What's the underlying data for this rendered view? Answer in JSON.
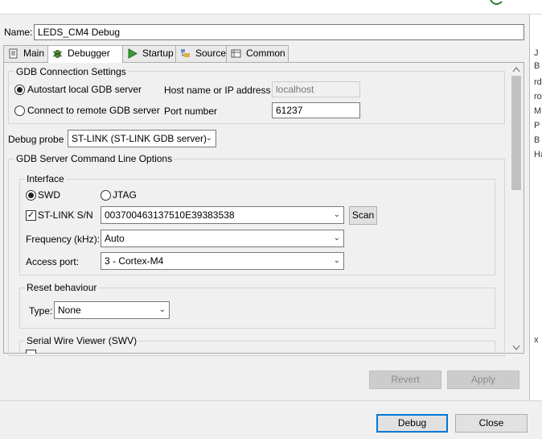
{
  "name": {
    "label": "Name:",
    "value": "LEDS_CM4 Debug"
  },
  "tabs": [
    {
      "label": "Main",
      "icon": "document-icon"
    },
    {
      "label": "Debugger",
      "icon": "bug-icon"
    },
    {
      "label": "Startup",
      "icon": "play-icon"
    },
    {
      "label": "Source",
      "icon": "source-icon"
    },
    {
      "label": "Common",
      "icon": "table-icon"
    }
  ],
  "gdb_connection": {
    "title": "GDB Connection Settings",
    "autostart_label": "Autostart local GDB server",
    "remote_label": "Connect to remote GDB server",
    "host_label": "Host name or IP address",
    "host_value": "localhost",
    "port_label": "Port number",
    "port_value": "61237"
  },
  "debug_probe": {
    "label": "Debug probe",
    "value": "ST-LINK (ST-LINK GDB server)"
  },
  "gdb_server": {
    "title": "GDB Server Command Line Options",
    "interface": {
      "title": "Interface",
      "swd_label": "SWD",
      "jtag_label": "JTAG",
      "sn_label": "ST-LINK S/N",
      "sn_value": "003700463137510E39383538",
      "scan_label": "Scan",
      "freq_label": "Frequency (kHz):",
      "freq_value": "Auto",
      "port_label": "Access port:",
      "port_value": "3 - Cortex-M4"
    },
    "reset": {
      "title": "Reset behaviour",
      "type_label": "Type:",
      "type_value": "None"
    },
    "swv": {
      "title": "Serial Wire Viewer (SWV)"
    }
  },
  "buttons": {
    "revert": "Revert",
    "apply": "Apply",
    "debug": "Debug",
    "close": "Close"
  },
  "right_strip": [
    "J",
    "B",
    "rd",
    "ro",
    "M",
    "P",
    "B",
    "Ha",
    "x"
  ]
}
